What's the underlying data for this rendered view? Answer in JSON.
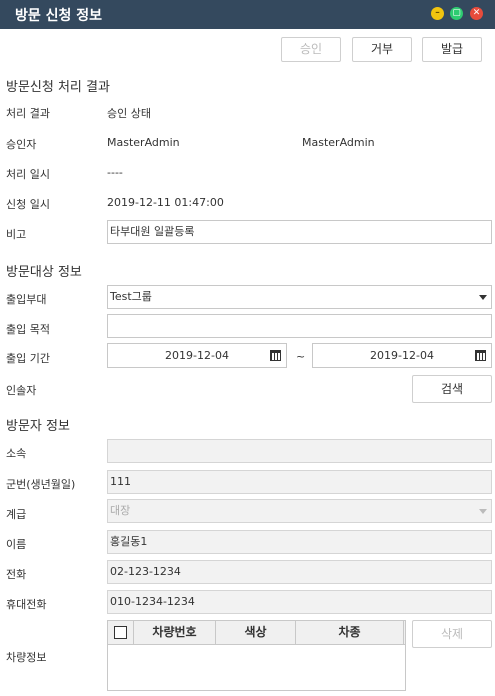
{
  "window": {
    "title": "방문 신청 정보"
  },
  "toolbar": {
    "approve_label": "승인",
    "reject_label": "거부",
    "issue_label": "발급"
  },
  "result_section": {
    "title": "방문신청 처리 결과",
    "status_label": "처리 결과",
    "status_value": "승인 상태",
    "approver_label": "승인자",
    "approver_value": "MasterAdmin",
    "approver_value2": "MasterAdmin",
    "processed_label": "처리 일시",
    "processed_value": "----",
    "requested_label": "신청 일시",
    "requested_value": "2019-12-11 01:47:00",
    "note_label": "비고",
    "note_value": "타부대원 일괄등록"
  },
  "target_section": {
    "title": "방문대상 정보",
    "dept_label": "출입부대",
    "dept_value": "Test그룹",
    "purpose_label": "출입 목적",
    "purpose_value": "",
    "period_label": "출입 기간",
    "period_start": "2019-12-04",
    "period_sep": "~",
    "period_end": "2019-12-04",
    "escort_label": "인솔자",
    "search_label": "검색"
  },
  "visitor_section": {
    "title": "방문자 정보",
    "affiliation_label": "소속",
    "affiliation_value": "",
    "service_no_label": "군번(생년월일)",
    "service_no_value": "111",
    "rank_label": "계급",
    "rank_value": "대장",
    "name_label": "이름",
    "name_value": "홍길동1",
    "phone_label": "전화",
    "phone_value": "02-123-1234",
    "mobile_label": "휴대전화",
    "mobile_value": "010-1234-1234",
    "vehicle_label": "차량정보",
    "vehicle_columns": [
      "차량번호",
      "색상",
      "차종"
    ],
    "delete_label": "삭제"
  },
  "colors": {
    "titlebar": "#34495e",
    "minimize": "#f1c40f",
    "maximize": "#2ecc71",
    "close": "#e74c3c"
  }
}
